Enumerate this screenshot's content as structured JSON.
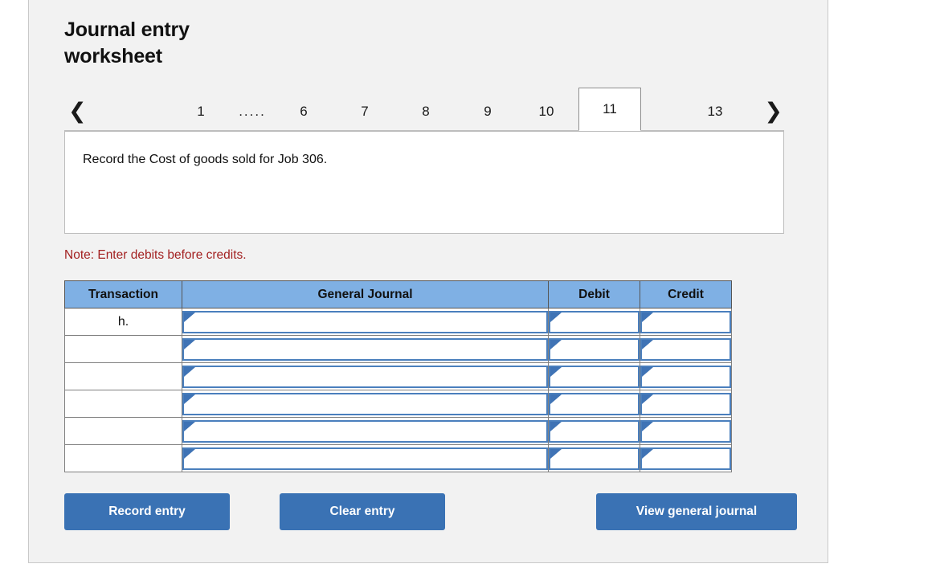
{
  "header": {
    "title_line1": "Journal entry",
    "title_line2": "worksheet"
  },
  "tabs": {
    "prev_icon": "chevron-left-icon",
    "next_icon": "chevron-right-icon",
    "items": [
      {
        "label": "1",
        "active": false
      },
      {
        "label": ".....",
        "active": false
      },
      {
        "label": "6",
        "active": false
      },
      {
        "label": "7",
        "active": false
      },
      {
        "label": "8",
        "active": false
      },
      {
        "label": "9",
        "active": false
      },
      {
        "label": "10",
        "active": false
      },
      {
        "label": "11",
        "active": true
      },
      {
        "label": "13",
        "active": false
      }
    ],
    "active_label": "11"
  },
  "instruction": {
    "text": "Record the Cost of goods sold for Job 306."
  },
  "note": {
    "text": "Note: Enter debits before credits."
  },
  "table": {
    "columns": [
      "Transaction",
      "General Journal",
      "Debit",
      "Credit"
    ],
    "rows": [
      {
        "transaction": "h.",
        "general_journal": "",
        "debit": "",
        "credit": ""
      },
      {
        "transaction": "",
        "general_journal": "",
        "debit": "",
        "credit": ""
      },
      {
        "transaction": "",
        "general_journal": "",
        "debit": "",
        "credit": ""
      },
      {
        "transaction": "",
        "general_journal": "",
        "debit": "",
        "credit": ""
      },
      {
        "transaction": "",
        "general_journal": "",
        "debit": "",
        "credit": ""
      },
      {
        "transaction": "",
        "general_journal": "",
        "debit": "",
        "credit": ""
      }
    ]
  },
  "buttons": {
    "record": "Record entry",
    "clear": "Clear entry",
    "view": "View general journal"
  },
  "colors": {
    "panel_bg": "#f2f2f2",
    "header_blue": "#7fb0e4",
    "button_blue": "#3a72b4",
    "note_red": "#a32121",
    "field_border_blue": "#4a7fbd"
  }
}
